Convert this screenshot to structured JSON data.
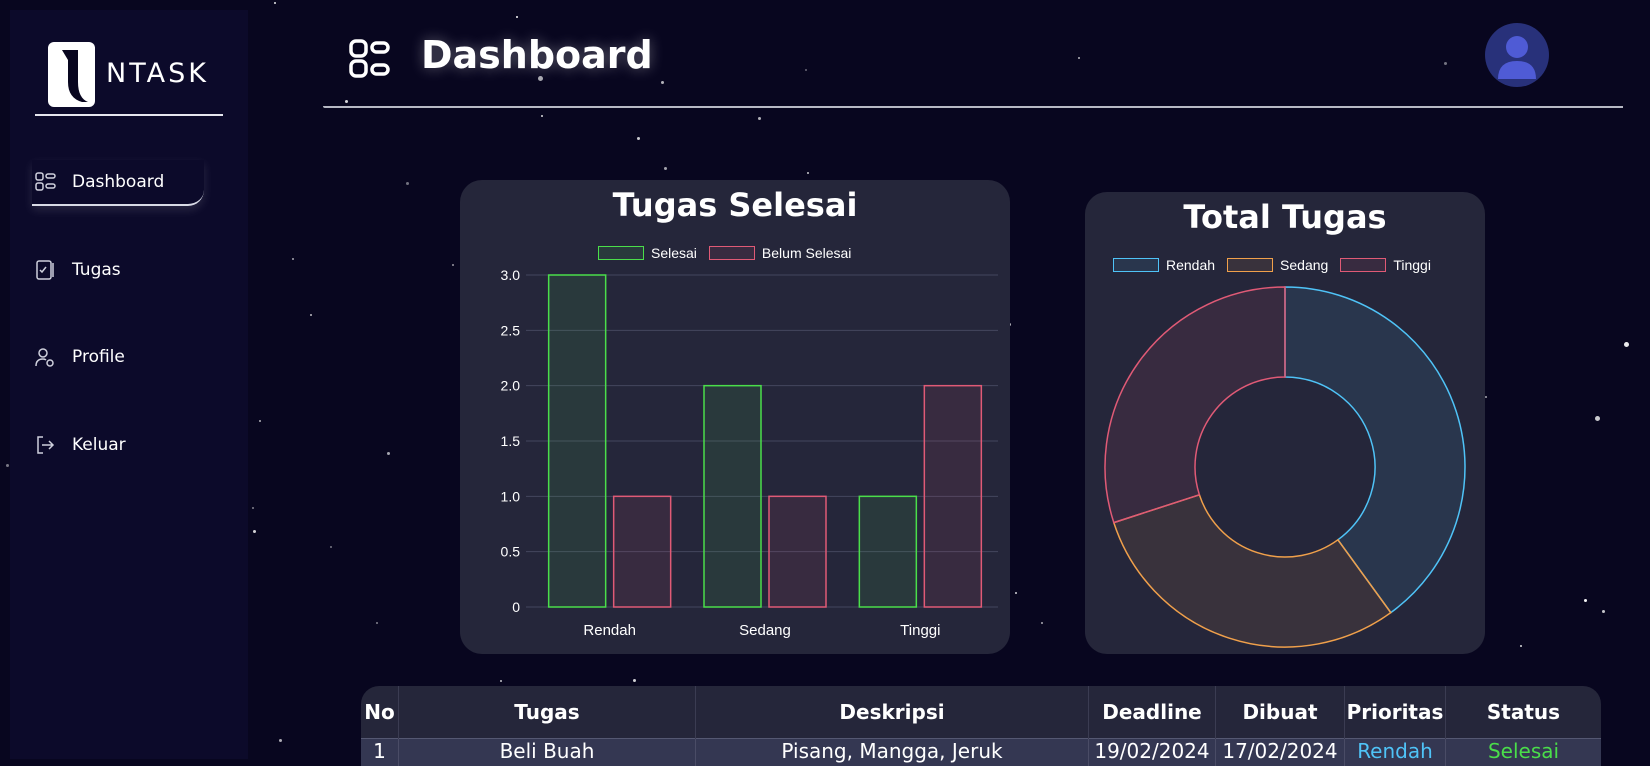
{
  "app": {
    "logo_text": "NTASK",
    "page_title": "Dashboard"
  },
  "sidebar": {
    "items": [
      {
        "label": "Dashboard",
        "icon": "dashboard-icon",
        "active": true
      },
      {
        "label": "Tugas",
        "icon": "task-book-icon",
        "active": false
      },
      {
        "label": "Profile",
        "icon": "user-settings-icon",
        "active": false
      },
      {
        "label": "Keluar",
        "icon": "logout-icon",
        "active": false
      }
    ]
  },
  "header": {
    "avatar_icon": "user-avatar-icon"
  },
  "chart_data": [
    {
      "type": "bar",
      "title": "Tugas Selesai",
      "categories": [
        "Rendah",
        "Sedang",
        "Tinggi"
      ],
      "series": [
        {
          "name": "Selesai",
          "values": [
            3,
            2,
            1
          ],
          "color": "#4ade4a"
        },
        {
          "name": "Belum Selesai",
          "values": [
            1,
            1,
            2
          ],
          "color": "#e05a76"
        }
      ],
      "ylim": [
        0,
        3
      ],
      "yticks": [
        "0",
        "0.5",
        "1.0",
        "1.5",
        "2.0",
        "2.5",
        "3.0"
      ],
      "grid": true,
      "legend": "top"
    },
    {
      "type": "pie",
      "title": "Total Tugas",
      "labels": [
        "Rendah",
        "Sedang",
        "Tinggi"
      ],
      "values": [
        4,
        3,
        3
      ],
      "colors": [
        "#4fc3f7",
        "#f0a04b",
        "#e05a76"
      ],
      "legend": "top"
    }
  ],
  "table": {
    "headers": [
      "No",
      "Tugas",
      "Deskripsi",
      "Deadline",
      "Dibuat",
      "Prioritas",
      "Status"
    ],
    "rows": [
      [
        "1",
        "Beli Buah",
        "Pisang, Mangga, Jeruk",
        "19/02/2024",
        "17/02/2024",
        "Rendah",
        "Selesai"
      ]
    ]
  },
  "colors": {
    "background": "#08061f",
    "card": "#25263a",
    "priority_low": "#4fc3f7",
    "status_done": "#4ade4a"
  }
}
